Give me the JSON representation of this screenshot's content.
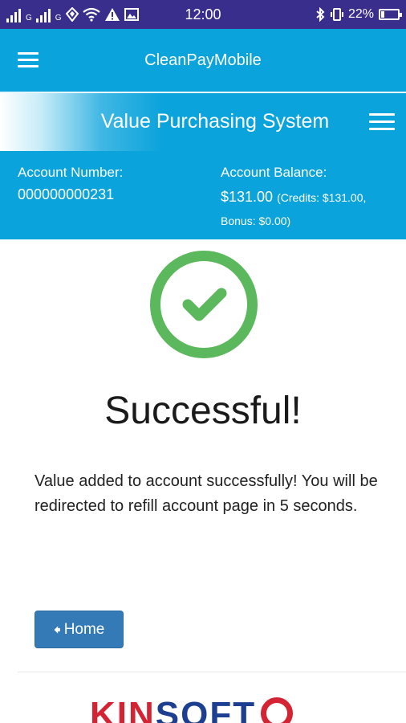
{
  "status_bar": {
    "signal_label": "G",
    "time": "12:00",
    "battery": "22%",
    "battery_level": 0.22,
    "icons": [
      "signal-icon",
      "signal-icon",
      "data-icon",
      "wifi-icon",
      "warning-icon",
      "image-icon",
      "bluetooth-icon",
      "vibrate-icon",
      "battery-icon"
    ]
  },
  "app_bar": {
    "title": "CleanPayMobile",
    "menu_icon": "menu-icon"
  },
  "banner": {
    "title": "Value Purchasing System",
    "menu_icon": "menu-icon"
  },
  "account": {
    "number_label": "Account Number:",
    "number_value": "000000000231",
    "balance_label": "Account Balance:",
    "balance_value": "$131.00",
    "balance_detail": "(Credits: $131.00, Bonus: $0.00)"
  },
  "success": {
    "icon": "check-circle-icon",
    "color": "#5cb85c",
    "title": "Successful!",
    "message": "Value added to account successfully! You will be redirected to refill account page in 5 seconds."
  },
  "home_button": {
    "icon": "arrow-left-icon",
    "label": "Home"
  },
  "logo": {
    "text_red": "KIN",
    "text_blue": "SOFT"
  },
  "colors": {
    "status_bar": "#3a2e8c",
    "primary": "#0aa3dc",
    "button": "#337ab7",
    "success": "#5cb85c"
  }
}
